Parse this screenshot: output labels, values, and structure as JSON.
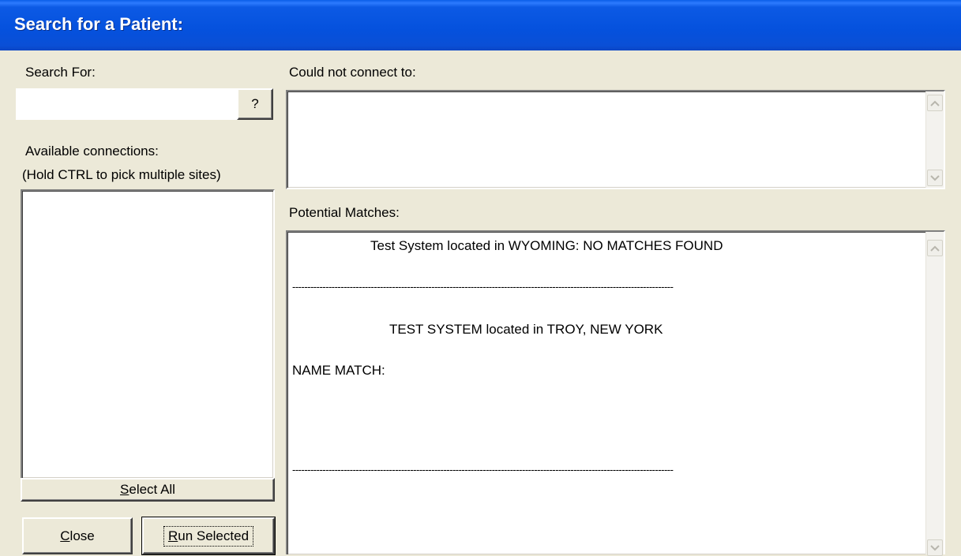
{
  "window": {
    "title": "Search for a Patient:"
  },
  "search": {
    "label": "Search For:",
    "value": "",
    "help_button_label": "?"
  },
  "connections": {
    "label_line1": "Available connections:",
    "label_line2": "(Hold CTRL to pick multiple sites)",
    "items": [],
    "select_all_label": "Select All",
    "select_all_mnemonic": "S",
    "select_all_rest": "elect All"
  },
  "buttons": {
    "close_label": "Close",
    "close_mnemonic": "C",
    "close_rest": "lose",
    "run_label": "Run Selected",
    "run_mnemonic": "R",
    "run_rest": "un Selected"
  },
  "could_not_connect": {
    "label": "Could not connect to:",
    "items": []
  },
  "potential_matches": {
    "label": "Potential Matches:",
    "lines": [
      "Test System located in WYOMING: NO MATCHES FOUND",
      "------------------------------------------------------------------------------------------------------------------------------",
      "TEST SYSTEM located in TROY, NEW YORK",
      "NAME MATCH:",
      "------------------------------------------------------------------------------------------------------------------------------"
    ]
  },
  "icons": {
    "scroll_up": "chevron-up-icon",
    "scroll_down": "chevron-down-icon"
  }
}
